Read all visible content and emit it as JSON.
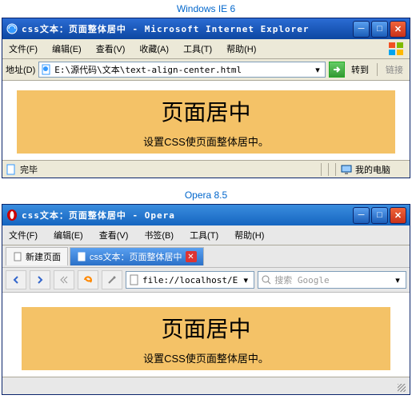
{
  "ie": {
    "caption": "Windows IE 6",
    "title": "css文本：页面整体居中 - Microsoft Internet Explorer",
    "menu": {
      "file": "文件(F)",
      "edit": "编辑(E)",
      "view": "查看(V)",
      "favorites": "收藏(A)",
      "tools": "工具(T)",
      "help": "帮助(H)"
    },
    "addr_label": "地址(D)",
    "url": "E:\\源代码\\文本\\text-align-center.html",
    "go": "转到",
    "links": "链接",
    "status_done": "完毕",
    "status_zone": "我的电脑"
  },
  "opera": {
    "caption": "Opera 8.5",
    "title": "css文本：页面整体居中 - Opera",
    "menu": {
      "file": "文件(F)",
      "edit": "编辑(E)",
      "view": "查看(V)",
      "bookmarks": "书签(B)",
      "tools": "工具(T)",
      "help": "帮助(H)"
    },
    "tab_new": "新建页面",
    "tab_active": "css文本：页面整体居中",
    "url": "file://localhost/E",
    "search_placeholder": "搜索 Google"
  },
  "page": {
    "heading": "页面居中",
    "subtext": "设置CSS使页面整体居中。"
  }
}
